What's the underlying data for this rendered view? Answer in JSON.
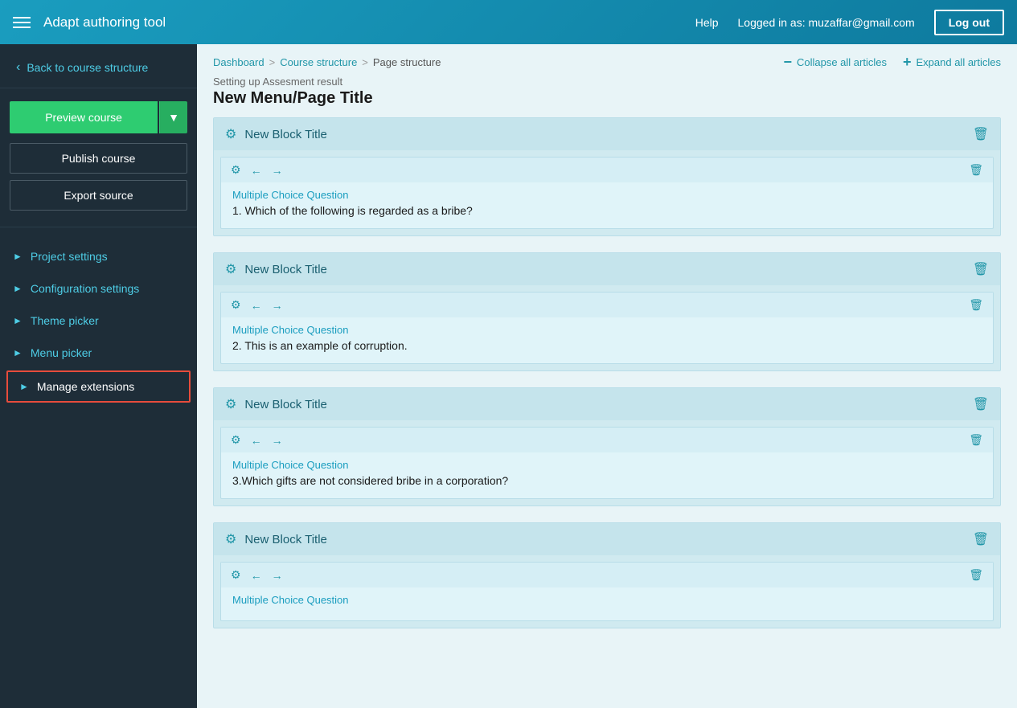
{
  "navbar": {
    "title": "Adapt authoring tool",
    "help": "Help",
    "user_label": "Logged in as: muzaffar@gmail.com",
    "logout_label": "Log out"
  },
  "sidebar": {
    "back_label": "Back to course structure",
    "preview_label": "Preview course",
    "publish_label": "Publish course",
    "export_label": "Export source",
    "items": [
      {
        "id": "project-settings",
        "label": "Project settings",
        "active": false
      },
      {
        "id": "configuration-settings",
        "label": "Configuration settings",
        "active": false
      },
      {
        "id": "theme-picker",
        "label": "Theme picker",
        "active": false
      },
      {
        "id": "menu-picker",
        "label": "Menu picker",
        "active": false
      },
      {
        "id": "manage-extensions",
        "label": "Manage extensions",
        "active": true
      }
    ]
  },
  "breadcrumb": {
    "dashboard": "Dashboard",
    "course_structure": "Course structure",
    "page_structure": "Page structure",
    "subtitle": "Setting up Assesment result",
    "title": "New Menu/Page Title",
    "collapse_label": "Collapse all articles",
    "expand_label": "Expand all articles"
  },
  "blocks": [
    {
      "id": "block-1",
      "title": "New Block Title",
      "components": [
        {
          "id": "comp-1",
          "type": "Multiple Choice Question",
          "question": "1. Which of the following is regarded as a bribe?"
        }
      ]
    },
    {
      "id": "block-2",
      "title": "New Block Title",
      "components": [
        {
          "id": "comp-2",
          "type": "Multiple Choice Question",
          "question": "2. This is an example of corruption."
        }
      ]
    },
    {
      "id": "block-3",
      "title": "New Block Title",
      "components": [
        {
          "id": "comp-3",
          "type": "Multiple Choice Question",
          "question": "3.Which gifts are not considered bribe in a corporation?"
        }
      ]
    },
    {
      "id": "block-4",
      "title": "New Block Title",
      "components": [
        {
          "id": "comp-4",
          "type": "Multiple Choice Question",
          "question": ""
        }
      ]
    }
  ]
}
